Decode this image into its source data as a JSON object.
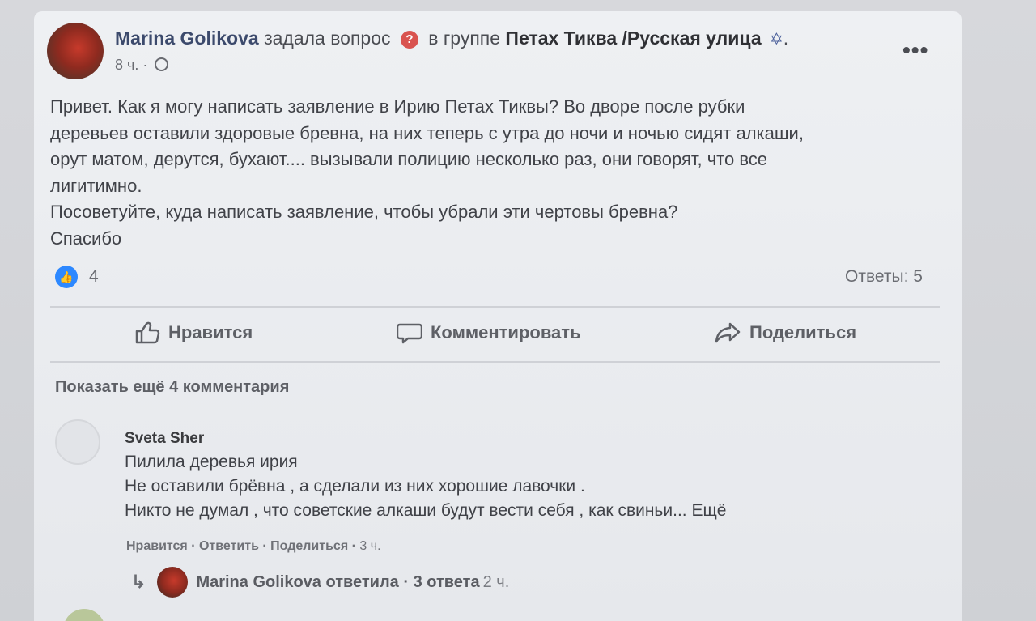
{
  "post": {
    "author": "Marina Golikova",
    "action_text": "задала вопрос",
    "in_group_text": "в группе",
    "group_name": "Петах Тиква /Русская улица",
    "group_suffix": ".",
    "time": "8 ч. ·",
    "body_lines": [
      "Привет. Как я могу написать заявление в Ирию Петах Тиквы? Во дворе после рубки",
      "деревьев оставили здоровые бревна, на них теперь с утра до ночи и ночью сидят алкаши,",
      "орут матом, дерутся, бухают.... вызывали полицию несколько раз, они говорят, что все",
      "лигитимно.",
      "Посоветуйте, куда написать заявление, чтобы убрали эти чертовы бревна?",
      "Спасибо"
    ],
    "likes_count": "4",
    "answers_label": "Ответы: 5"
  },
  "actions": {
    "like": "Нравится",
    "comment": "Комментировать",
    "share": "Поделиться"
  },
  "comments": {
    "show_more": "Показать ещё 4 комментария",
    "first": {
      "author": "Sveta Sher",
      "lines": [
        "Пилила деревья ирия",
        "Не оставили брёвна , а сделали из них хорошие лавочки .",
        "Никто не думал , что советские алкаши будут вести себя , как свиньи... Ещё"
      ],
      "like": "Нравится",
      "reply": "Ответить",
      "share": "Поделиться",
      "time": "3 ч."
    },
    "reply_summary": {
      "text": "Marina Golikova ответила · 3 ответа",
      "time": "2 ч."
    }
  },
  "icons": {
    "question": "question-icon",
    "globe": "globe-icon",
    "more": "more-options-icon",
    "like": "thumbs-up-icon",
    "comment": "comment-bubble-icon",
    "share": "share-arrow-icon",
    "reply": "reply-arrow-icon"
  },
  "colors": {
    "like_badge": "#2d88ff",
    "question_badge": "#d9534f"
  }
}
